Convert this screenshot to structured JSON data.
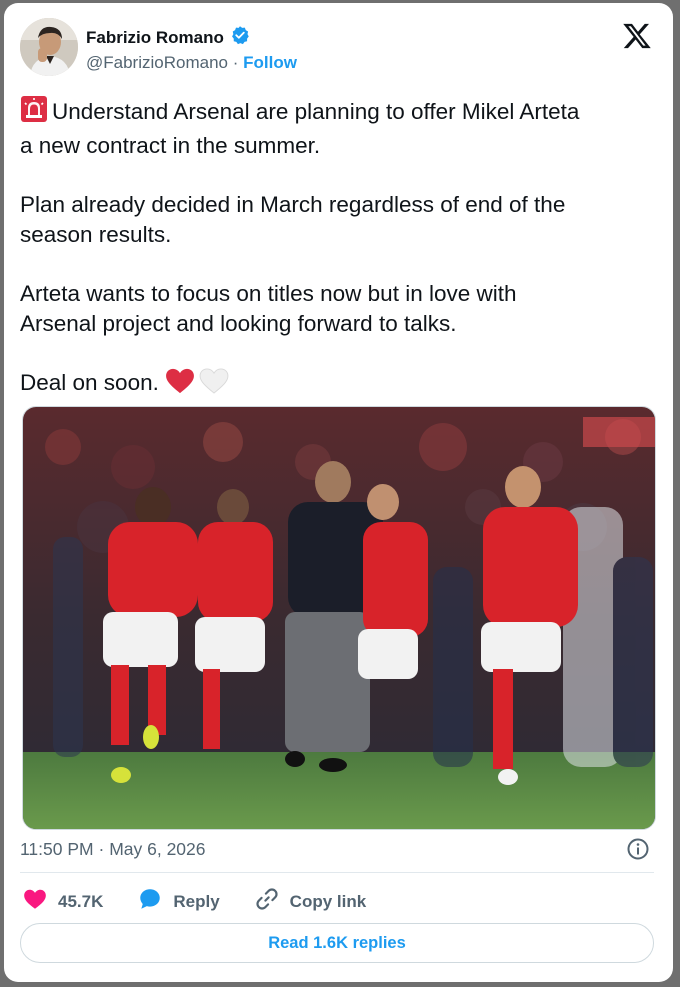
{
  "author": {
    "name": "Fabrizio Romano",
    "handle": "@FabrizioRomano",
    "separator": "·",
    "follow_label": "Follow",
    "verified": true,
    "verified_color": "#1d9bf0"
  },
  "tweet": {
    "paragraphs": [
      "Understand Arsenal are planning to offer Mikel Arteta",
      "a new contract in the summer.",
      "Plan already decided in March regardless of end of the",
      "season results.",
      "Arteta wants to focus on titles now but in love with",
      "Arsenal project and looking forward to talks.",
      "Deal on soon."
    ],
    "leading_emoji": "siren-icon",
    "trailing_emoji": [
      "red-heart-icon",
      "white-heart-icon"
    ]
  },
  "media": {
    "description_icon": "photo"
  },
  "meta": {
    "time": "11:50 PM",
    "separator": "·",
    "date": "May 6, 2026"
  },
  "actions": {
    "likes": "45.7K",
    "reply_label": "Reply",
    "copy_label": "Copy link"
  },
  "read_replies_label": "Read 1.6K replies",
  "colors": {
    "accent": "#1d9bf0",
    "like": "#f91880",
    "text": "#0f1419",
    "muted": "#536471"
  }
}
